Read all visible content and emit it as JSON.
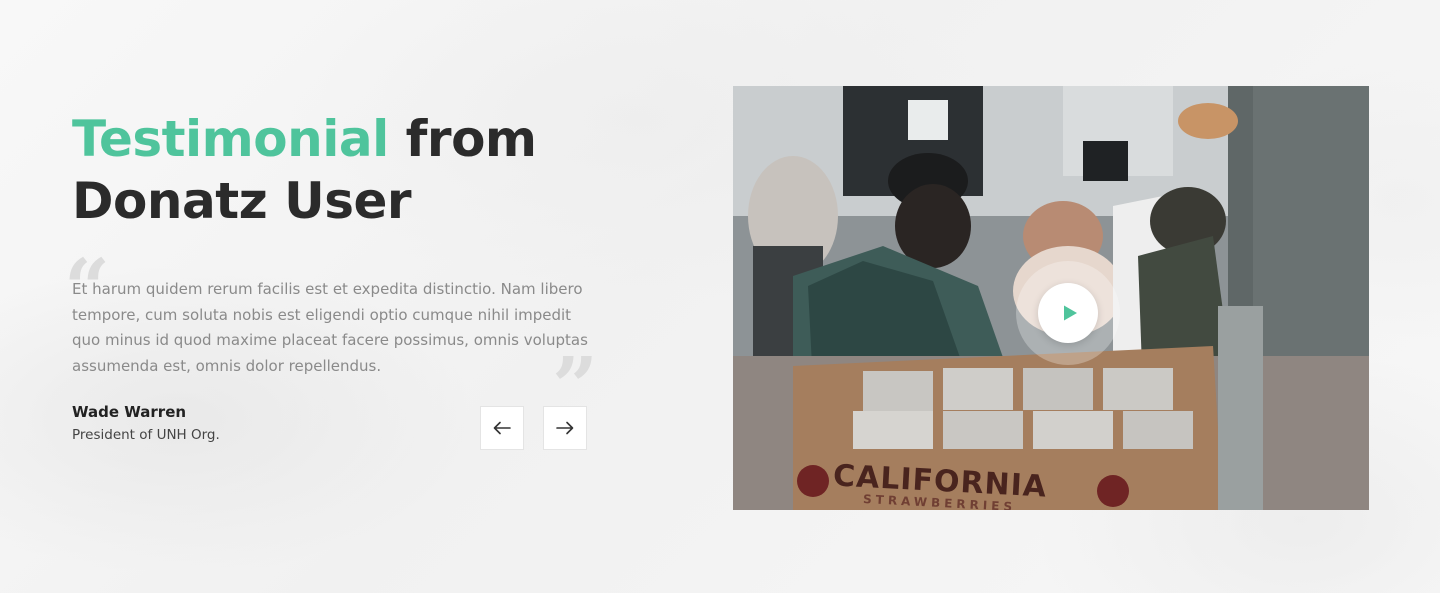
{
  "heading": {
    "accent": "Testimonial",
    "rest_line1": " from",
    "line2": "Donatz User"
  },
  "testimonial": {
    "text": "Et harum quidem rerum facilis est et expedita distinctio. Nam libero tempore, cum soluta nobis est eligendi optio cumque nihil impedit quo minus id quod maxime placeat facere possimus, omnis voluptas assumenda est, omnis dolor repellendus.",
    "open_quote": "“",
    "close_quote": "”",
    "author_name": "Wade Warren",
    "author_role": "President of UNH Org."
  },
  "navigation": {
    "prev_icon": "arrow-left-icon",
    "next_icon": "arrow-right-icon"
  },
  "video": {
    "play_icon": "play-icon",
    "box_label": "CALIFORNIA",
    "box_sublabel": "STRAWBERRIES"
  },
  "colors": {
    "accent": "#4fc49c",
    "heading": "#2b2b2b",
    "body_text": "#8a8a8a",
    "background": "#f6f6f6"
  }
}
